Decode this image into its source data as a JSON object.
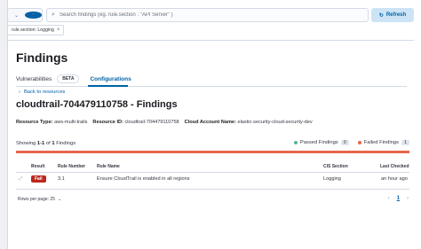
{
  "querybar": {
    "search_placeholder": "Search findings (eg. rule.section : \"API Server\" )",
    "refresh_label": "Refresh"
  },
  "filter": {
    "label": "rule.section: Logging"
  },
  "page": {
    "title": "Findings"
  },
  "tabs": [
    {
      "label": "Vulnerabilities",
      "badge": "BETA"
    },
    {
      "label": "Configurations"
    }
  ],
  "back_link": "Back to resources",
  "resource": {
    "title": "cloudtrail-704479110758 - Findings",
    "type_label": "Resource Type:",
    "type_value": "aws-multi-trails",
    "id_label": "Resource ID:",
    "id_value": "cloudtrail-704479110758",
    "account_label": "Cloud Account Name:",
    "account_value": "elastic-security-cloud-security-dev"
  },
  "summary": {
    "showing_prefix": "Showing",
    "range": "1-1",
    "of": "of",
    "total": "1",
    "suffix": "Findings",
    "passed_label": "Passed Findings",
    "passed_count": "0",
    "failed_label": "Failed Findings",
    "failed_count": "1",
    "passed_color": "#54b399",
    "failed_color": "#e7664c"
  },
  "table": {
    "headers": [
      "Result",
      "Rule Number",
      "Rule Name",
      "CIS Section",
      "Last Checked"
    ],
    "rows": [
      {
        "result": "Fail",
        "rule_number": "3.1",
        "rule_name": "Ensure CloudTrail is enabled in all regions",
        "cis_section": "Logging",
        "last_checked": "an hour ago"
      }
    ]
  },
  "footer": {
    "rows_per_page": "Rows per page: 25",
    "page": "1"
  }
}
